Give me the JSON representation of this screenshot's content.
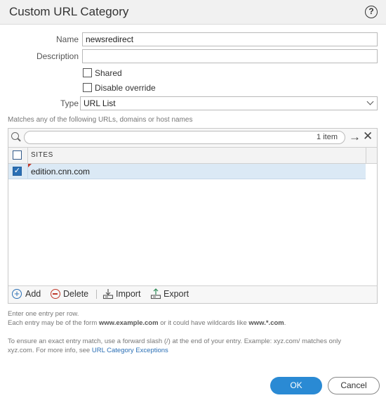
{
  "dialog": {
    "title": "Custom URL Category",
    "help": "?"
  },
  "form": {
    "name_label": "Name",
    "name_value": "newsredirect",
    "description_label": "Description",
    "description_value": "",
    "shared_label": "Shared",
    "shared_checked": false,
    "disable_override_label": "Disable override",
    "disable_override_checked": false,
    "type_label": "Type",
    "type_value": "URL List"
  },
  "list_hint": "Matches any of the following URLs, domains or host names",
  "grid": {
    "search_value": "",
    "count_text": "1 item",
    "column_header": "SITES",
    "rows": [
      {
        "site": "edition.cnn.com",
        "checked": true
      }
    ]
  },
  "toolbar": {
    "add_label": "Add",
    "delete_label": "Delete",
    "import_label": "Import",
    "export_label": "Export"
  },
  "notes": {
    "line1": "Enter one entry per row.",
    "line2_prefix": "Each entry may be of the form ",
    "line2_example1": "www.example.com",
    "line2_middle": " or it could have wildcards like ",
    "line2_example2": "www.*.com",
    "line2_suffix": ".",
    "line3": "To ensure an exact entry match, use a forward slash (/) at the end of your entry. Example: xyz.com/ matches only",
    "line4_prefix": "xyz.com. For more info, see ",
    "line4_link": "URL Category Exceptions"
  },
  "buttons": {
    "ok": "OK",
    "cancel": "Cancel"
  },
  "colors": {
    "accent": "#2a8ad4",
    "selected_row": "#dbe9f5",
    "delete": "#c0392b"
  }
}
